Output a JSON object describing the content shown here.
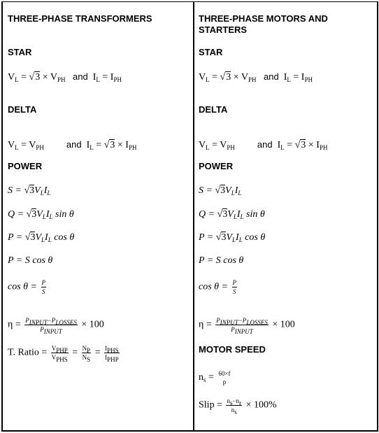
{
  "columns": [
    {
      "title": "THREE-PHASE TRANSFORMERS",
      "star": {
        "heading": "STAR",
        "vl": "V",
        "vl_sub": "L",
        "eq1": " = ",
        "sqrt3": "3",
        "times": " × V",
        "vph_sub": "PH",
        "and": "and",
        "il": "I",
        "il_sub": "L",
        "eq2": " = I",
        "iph_sub": "PH"
      },
      "delta": {
        "heading": "DELTA",
        "vl": "V",
        "vl_sub": "L",
        "eq1": " = V",
        "vph_sub": "PH",
        "and": "and",
        "il": "I",
        "il_sub": "L",
        "eq2": " = ",
        "sqrt3": "3",
        "times": " × I",
        "iph_sub": "PH"
      },
      "power": {
        "heading": "POWER",
        "formulas": [
          "S = √3V_L I_L",
          "Q = √3V_L I_L sin θ",
          "P = √3V_L I_L cos θ",
          "P = S cos θ",
          "cos θ = P/S"
        ],
        "s_lhs": "S = ",
        "q_lhs": "Q = ",
        "p_lhs": "P = ",
        "sin_suffix": " sin θ",
        "cos_suffix": " cos θ",
        "p_s_cos": "P = S cos θ",
        "cos_lhs": "cos θ = ",
        "cos_num": "P",
        "cos_den": "S"
      },
      "efficiency": {
        "lhs": "η = ",
        "num": "P_INPUT − P_LOSSES",
        "den": "P_INPUT",
        "rhs": " × 100"
      },
      "ratio": {
        "lhs": "T. Ratio = ",
        "f1_num": "V_PHP",
        "f1_den": "V_PHS",
        "f2_num": "N_P",
        "f2_den": "N_S",
        "f3_num": "I_PHS",
        "f3_den": "I_PHP"
      }
    },
    {
      "title_line1": "THREE-PHASE MOTORS AND",
      "title_line2": "STARTERS",
      "star": {
        "heading": "STAR"
      },
      "delta": {
        "heading": "DELTA"
      },
      "power": {
        "heading": "POWER"
      },
      "efficiency": {
        "lhs": "η = ",
        "rhs": " × 100"
      },
      "motor_speed": {
        "heading": "MOTOR SPEED",
        "ns_lhs": "n",
        "ns_sub": "s",
        "ns_eq": " = ",
        "ns_num": "60×f",
        "ns_den": "p",
        "slip_lhs": "Slip = ",
        "slip_num": "n_s − n_r",
        "slip_den": "n_s",
        "slip_rhs": " × 100%"
      }
    }
  ]
}
